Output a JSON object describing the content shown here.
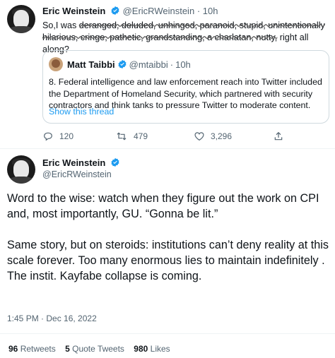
{
  "quoted_tweet": {
    "author_name": "Eric Weinstein",
    "author_handle": "@EricRWeinstein",
    "time": "10h",
    "text_prefix": "So,I was ",
    "struck_words": "deranged, deluded, unhinged, paranoid, stupid, unintentionally hilarious, cringe, pathetic, grandstanding, a charlatan, nutty,",
    "text_suffix": " right all along?",
    "embedded": {
      "author_name": "Matt Taibbi",
      "author_handle": "@mtaibbi",
      "time": "10h",
      "text": "8. Federal intelligence and law enforcement reach into Twitter included the Department of Homeland Security, which partnered with security contractors and think tanks to pressure Twitter to moderate content.",
      "link": "Show this thread"
    },
    "actions": {
      "replies": "120",
      "retweets": "479",
      "likes": "3,296"
    }
  },
  "main_tweet": {
    "author_name": "Eric Weinstein",
    "author_handle": "@EricRWeinstein",
    "paragraph_1": "Word to the wise: watch when they figure out the work on CPI and, most importantly, GU. “Gonna be lit.”",
    "paragraph_2": "Same story, but on steroids: institutions can’t deny reality at this scale forever. Too many enormous lies to maintain indefinitely . The instit. Kayfabe collapse is coming.",
    "timestamp": "1:45 PM · Dec 16, 2022",
    "stats": {
      "retweets_count": "96",
      "retweets_label": "Retweets",
      "quotes_count": "5",
      "quotes_label": "Quote Tweets",
      "likes_count": "980",
      "likes_label": "Likes"
    }
  },
  "colors": {
    "verified": "#1d9bf0",
    "link": "#1d9bf0",
    "secondary_text": "#536471"
  }
}
